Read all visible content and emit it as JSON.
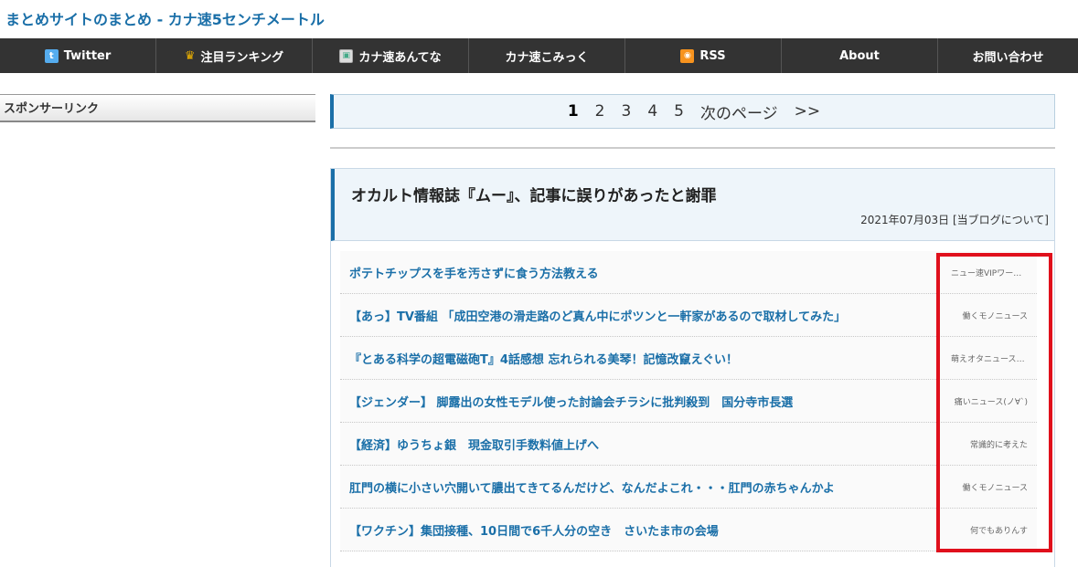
{
  "site": {
    "title": "まとめサイトのまとめ - カナ速5センチメートル"
  },
  "nav": [
    {
      "label": "Twitter",
      "icon": "twitter-icon"
    },
    {
      "label": "注目ランキング",
      "icon": "crown-icon"
    },
    {
      "label": "カナ速あんてな",
      "icon": "image-icon"
    },
    {
      "label": "カナ速こみっく",
      "icon": ""
    },
    {
      "label": "RSS",
      "icon": "rss-icon"
    },
    {
      "label": "About",
      "icon": ""
    },
    {
      "label": "お問い合わせ",
      "icon": ""
    }
  ],
  "sidebar": {
    "sponsor_label": "スポンサーリンク"
  },
  "pagination": {
    "pages": [
      "1",
      "2",
      "3",
      "4",
      "5"
    ],
    "current": "1",
    "next_label": "次のページ",
    "last_label": ">>"
  },
  "article": {
    "title": "オカルト情報誌『ムー』、記事に誤りがあったと謝罪",
    "date": "2021年07月03日",
    "category": "[当ブログについて]",
    "links": [
      {
        "title": "ポテトチップスを手を汚さずに食う方法教える",
        "source": "ニュー速VIPワールド"
      },
      {
        "title": "【あっ】TV番組 「成田空港の滑走路のど真ん中にポツンと一軒家があるので取材してみた」",
        "source": "働くモノニュース"
      },
      {
        "title": "『とある科学の超電磁砲T』4話感想 忘れられる美琴！記憶改竄えぐい！",
        "source": "萌えオタニュース速報"
      },
      {
        "title": "【ジェンダー】 脚露出の女性モデル使った討論会チラシに批判殺到　国分寺市長選",
        "source": "痛いニュース(ノ∀`)"
      },
      {
        "title": "【経済】ゆうちょ銀　現金取引手数料値上げへ",
        "source": "常識的に考えた"
      },
      {
        "title": "肛門の横に小さい穴開いて膿出てきてるんだけど、なんだよこれ・・・肛門の赤ちゃんかよ",
        "source": "働くモノニュース"
      },
      {
        "title": "【ワクチン】集団接種、10日間で6千人分の空き　さいたま市の会場",
        "source": "何でもありんす"
      }
    ]
  },
  "colors": {
    "accent": "#1a6fa8",
    "nav_bg": "#333333",
    "highlight": "#e0101c"
  }
}
